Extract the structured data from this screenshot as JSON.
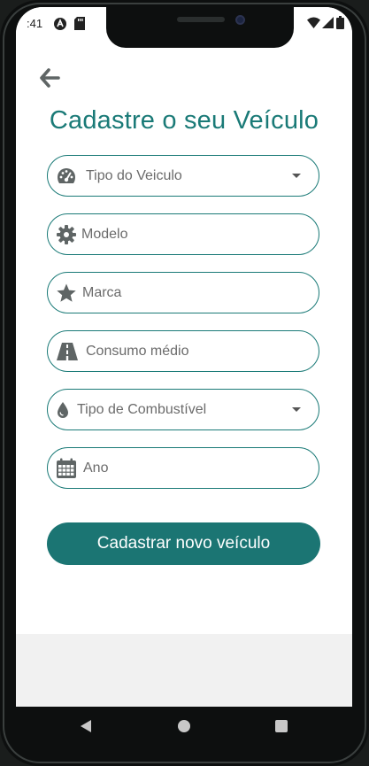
{
  "status_bar": {
    "time": ":41",
    "icons": [
      "android-icon",
      "sd-card-icon",
      "wifi-icon",
      "signal-icon",
      "battery-icon"
    ]
  },
  "page": {
    "back_icon": "arrow-left-icon",
    "title": "Cadastre o seu Veículo"
  },
  "form": {
    "fields": [
      {
        "placeholder": "Tipo do Veiculo",
        "icon": "speedometer-icon",
        "type": "dropdown"
      },
      {
        "placeholder": "Modelo",
        "icon": "gear-icon",
        "type": "text"
      },
      {
        "placeholder": "Marca",
        "icon": "star-icon",
        "type": "text"
      },
      {
        "placeholder": "Consumo médio",
        "icon": "road-icon",
        "type": "text"
      },
      {
        "placeholder": "Tipo de Combustível",
        "icon": "fuel-drop-icon",
        "type": "dropdown"
      },
      {
        "placeholder": "Ano",
        "icon": "calendar-icon",
        "type": "text"
      }
    ],
    "submit_label": "Cadastrar novo veículo"
  },
  "colors": {
    "accent": "#1a7a77",
    "button": "#1b7573",
    "placeholder": "#6b6b6b",
    "background_lower": "#f1f1f1"
  },
  "system_nav": {
    "buttons": [
      "nav-back-icon",
      "nav-home-icon",
      "nav-recents-icon"
    ]
  }
}
